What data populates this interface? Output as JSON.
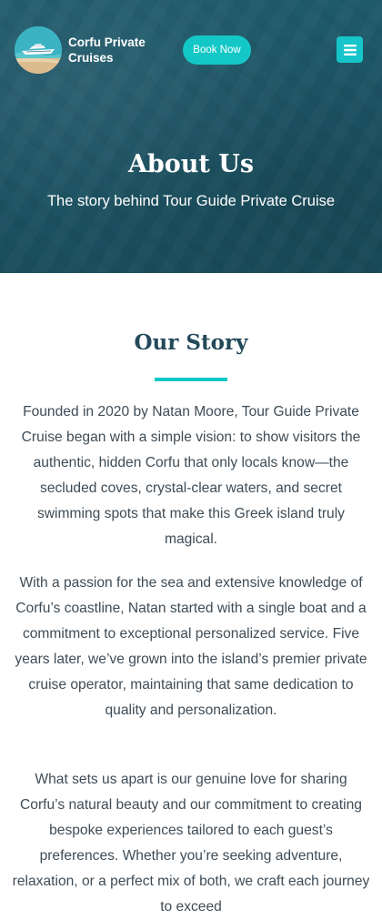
{
  "header": {
    "brand_line1": "Corfu Private",
    "brand_line2": "Cruises",
    "book_label": "Book Now",
    "menu_icon": "hamburger-menu-icon"
  },
  "hero": {
    "title": "About Us",
    "subtitle": "The story behind Tour Guide Private Cruise"
  },
  "story": {
    "title": "Our Story",
    "paragraphs": [
      "Founded in 2020 by Natan Moore, Tour Guide Private Cruise began with a simple vision: to show visitors the authentic, hidden Corfu that only locals know—the secluded coves, crystal-clear waters, and secret swimming spots that make this Greek island truly magical.",
      "With a passion for the sea and extensive knowledge of Corfu’s coastline, Natan started with a single boat and a commitment to exceptional personalized service. Five years later, we’ve grown into the island’s premier private cruise operator, maintaining that same dedication to quality and personalization.",
      "What sets us apart is our genuine love for sharing Corfu’s natural beauty and our commitment to creating bespoke experiences tailored to each guest’s preferences. Whether you’re seeking adventure, relaxation, or a perfect mix of both, we craft each journey to exceed"
    ]
  },
  "colors": {
    "accent": "#14c7c7",
    "hero_bg": "#1d5566",
    "heading": "#23495a",
    "body_text": "#3f4c56"
  }
}
